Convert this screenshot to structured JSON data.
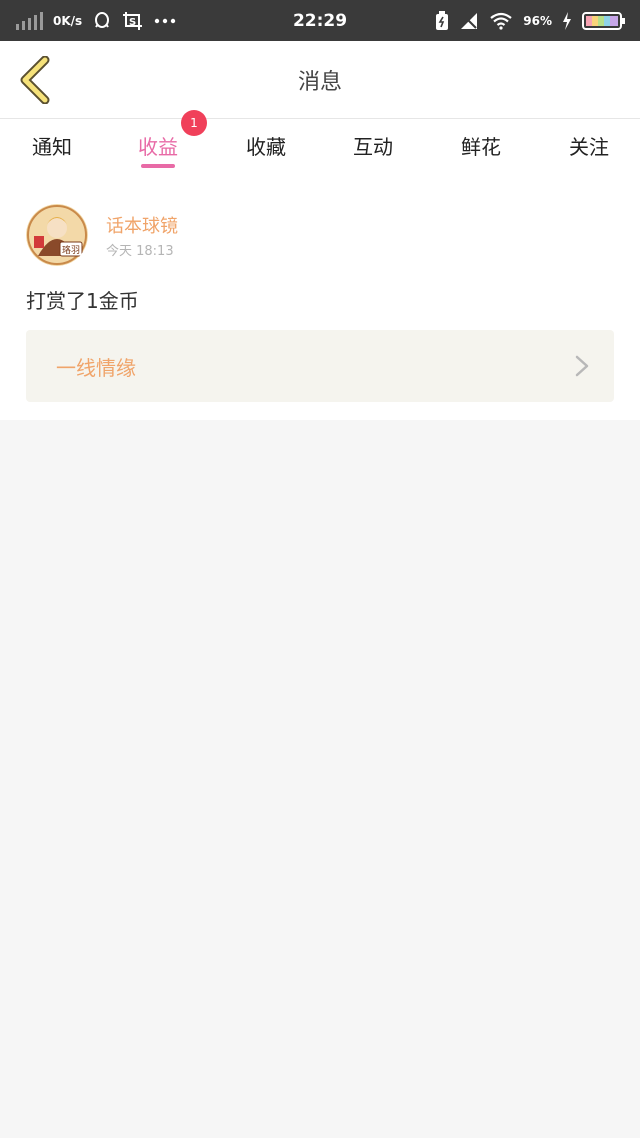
{
  "status_bar": {
    "net_speed": "0K/s",
    "time": "22:29",
    "battery_percent": "96%",
    "icons": [
      "signal-icon",
      "qq-icon",
      "screenshot-icon",
      "s-app-icon",
      "more-dots-icon",
      "battery-saver-icon",
      "no-sim-icon",
      "wifi-icon",
      "charging-icon",
      "battery-icon"
    ]
  },
  "header": {
    "title": "消息",
    "back_icon": "chevron-left-icon"
  },
  "tabs": {
    "items": [
      {
        "label": "通知",
        "active": false
      },
      {
        "label": "收益",
        "active": true,
        "badge": "1"
      },
      {
        "label": "收藏",
        "active": false
      },
      {
        "label": "互动",
        "active": false
      },
      {
        "label": "鲜花",
        "active": false
      },
      {
        "label": "关注",
        "active": false
      }
    ]
  },
  "notification": {
    "username": "话本球镜",
    "time": "今天 18:13",
    "message": "打赏了1金币",
    "book_title": "一线情缘",
    "avatar_text": "珞羽"
  },
  "colors": {
    "accent_pink": "#e86aa6",
    "username_orange": "#f0a46a",
    "badge_red": "#f0405a",
    "status_bar_bg": "#3a3a3a",
    "back_icon_yellow": "#f6e27a"
  }
}
